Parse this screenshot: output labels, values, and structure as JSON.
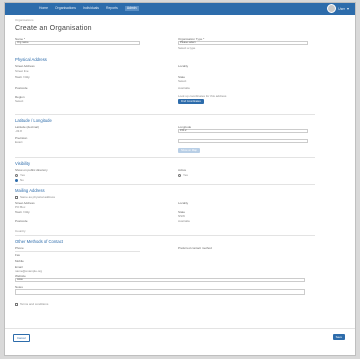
{
  "topnav": {
    "items": [
      "Home",
      "Organisations",
      "Individuals",
      "Reports",
      "Admin"
    ],
    "active_index": 4,
    "user_label": "User"
  },
  "breadcrumb": "Organisations",
  "page_title": "Create an Organisation",
  "basic": {
    "name_label": "Name *",
    "name_value": "Org name",
    "type_label": "Organisation Type *",
    "type_value": "Please select",
    "type_help": "Select a type"
  },
  "physical": {
    "heading": "Physical Address",
    "street_label": "Street Address",
    "street_value": "Street line",
    "locality_label": "Locality",
    "city_label": "Town / City",
    "state_label": "State",
    "state_value": "Select",
    "postcode_label": "Postcode",
    "country_label": "Country",
    "country_value": "Australia",
    "region_label": "Region",
    "region_value": "Select",
    "lookup_help": "Look up coordinates for this address",
    "lookup_button": "Find Coordinates"
  },
  "latlng": {
    "heading": "Latitude / Longitude",
    "lat_label": "Latitude (decimal)",
    "lat_value": "-33.8",
    "lng_label": "Longitude",
    "lng_value": "151.2",
    "precision_label": "Precision",
    "precision_value": "Exact",
    "map_button": "Show on Map"
  },
  "visibility": {
    "heading": "Visibility",
    "public_label": "Show on public directory",
    "option_yes": "Yes",
    "option_no": "No",
    "active_label": "Active",
    "active_yes": "Yes"
  },
  "mailing": {
    "heading": "Mailing Address",
    "same_label": "Same as physical address",
    "street_label": "Street Address",
    "street_value": "PO Box",
    "locality_label": "Locality",
    "city_label": "Town / City",
    "state_label": "State",
    "state_value": "NSW",
    "postcode_label": "Postcode",
    "country_label": "Country",
    "country_value": "Australia"
  },
  "contact": {
    "heading": "Other Methods of Contact",
    "phone_label": "Phone",
    "fax_label": "Fax",
    "mobile_label": "Mobile",
    "email_label": "Email",
    "email_value": "name@example.org",
    "website_label": "Website",
    "website_value": "www.",
    "preferred_label": "Preferred contact method",
    "notes_label": "Notes",
    "terms_label": "Terms and conditions"
  },
  "footer": {
    "cancel_button": "Cancel",
    "save_button": "Save"
  },
  "colors": {
    "brand": "#2d6cab",
    "pale_button": "#b9cfe6"
  }
}
